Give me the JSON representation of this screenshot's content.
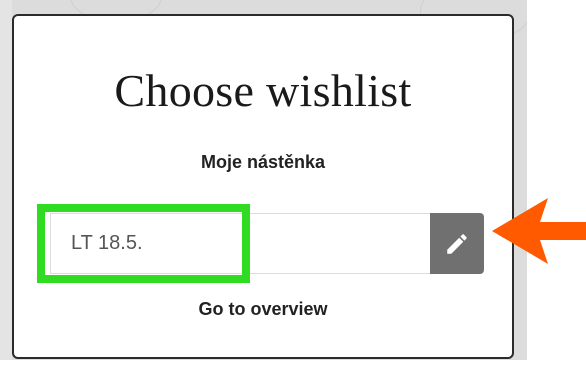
{
  "modal": {
    "title": "Choose wishlist",
    "board_name": "Moje nástěnka",
    "wishlist_item": {
      "label": "LT 18.5."
    },
    "edit_icon": "pencil-icon",
    "overview_link": "Go to overview"
  },
  "annotations": {
    "highlight_color": "#2fdc22",
    "arrow_color": "#ff5a00"
  },
  "colors": {
    "edit_button_bg": "#707070",
    "modal_border": "#2b2b2b"
  }
}
